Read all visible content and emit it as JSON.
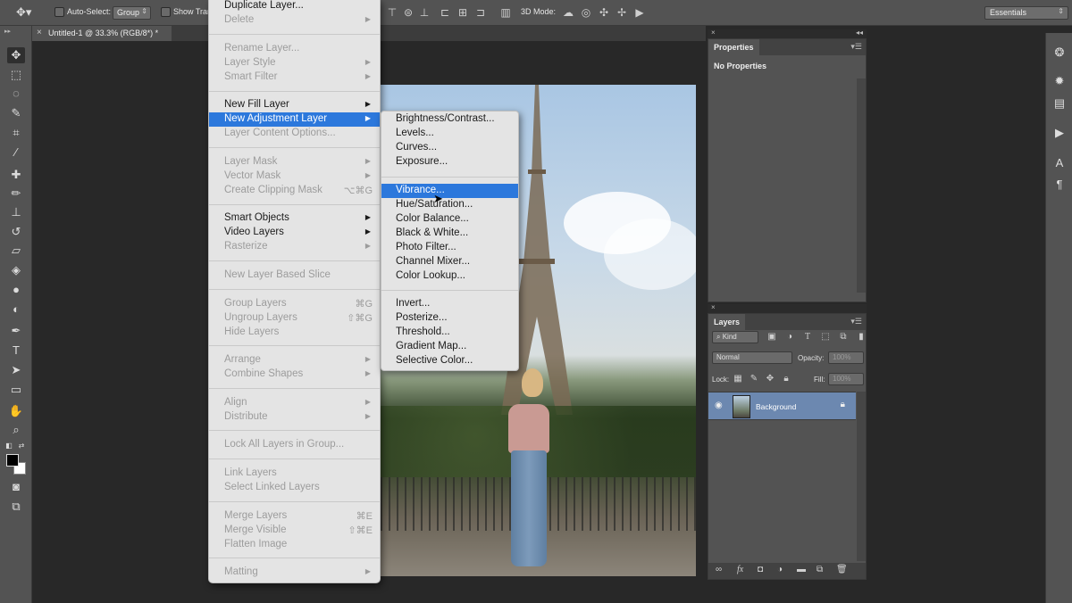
{
  "options_bar": {
    "auto_select_label": "Auto-Select:",
    "auto_select_value": "Group",
    "show_transform_label": "Show Tran",
    "mode_3d_label": "3D Mode:",
    "workspace": "Essentials"
  },
  "document_tab": {
    "title": "Untitled-1 @ 33.3% (RGB/8*) *",
    "close": "×"
  },
  "layer_menu": {
    "items": [
      {
        "label": "Duplicate Layer...",
        "enabled": true
      },
      {
        "label": "Delete",
        "enabled": false,
        "submenu": true
      },
      {
        "label": "Rename Layer...",
        "enabled": false
      },
      {
        "label": "Layer Style",
        "enabled": false,
        "submenu": true
      },
      {
        "label": "Smart Filter",
        "enabled": false,
        "submenu": true
      },
      {
        "label": "New Fill Layer",
        "enabled": true,
        "submenu": true
      },
      {
        "label": "New Adjustment Layer",
        "enabled": true,
        "submenu": true,
        "highlighted": true
      },
      {
        "label": "Layer Content Options...",
        "enabled": false
      },
      {
        "label": "Layer Mask",
        "enabled": false,
        "submenu": true
      },
      {
        "label": "Vector Mask",
        "enabled": false,
        "submenu": true
      },
      {
        "label": "Create Clipping Mask",
        "enabled": false,
        "shortcut": "⌥⌘G"
      },
      {
        "label": "Smart Objects",
        "enabled": true,
        "submenu": true
      },
      {
        "label": "Video Layers",
        "enabled": true,
        "submenu": true
      },
      {
        "label": "Rasterize",
        "enabled": false,
        "submenu": true
      },
      {
        "label": "New Layer Based Slice",
        "enabled": false
      },
      {
        "label": "Group Layers",
        "enabled": false,
        "shortcut": "⌘G"
      },
      {
        "label": "Ungroup Layers",
        "enabled": false,
        "shortcut": "⇧⌘G"
      },
      {
        "label": "Hide Layers",
        "enabled": false
      },
      {
        "label": "Arrange",
        "enabled": false,
        "submenu": true
      },
      {
        "label": "Combine Shapes",
        "enabled": false,
        "submenu": true
      },
      {
        "label": "Align",
        "enabled": false,
        "submenu": true
      },
      {
        "label": "Distribute",
        "enabled": false,
        "submenu": true
      },
      {
        "label": "Lock All Layers in Group...",
        "enabled": false
      },
      {
        "label": "Link Layers",
        "enabled": false
      },
      {
        "label": "Select Linked Layers",
        "enabled": false
      },
      {
        "label": "Merge Layers",
        "enabled": false,
        "shortcut": "⌘E"
      },
      {
        "label": "Merge Visible",
        "enabled": false,
        "shortcut": "⇧⌘E"
      },
      {
        "label": "Flatten Image",
        "enabled": false
      },
      {
        "label": "Matting",
        "enabled": false,
        "submenu": true
      }
    ]
  },
  "adjustment_submenu": {
    "items": [
      "Brightness/Contrast...",
      "Levels...",
      "Curves...",
      "Exposure...",
      "Vibrance...",
      "Hue/Saturation...",
      "Color Balance...",
      "Black & White...",
      "Photo Filter...",
      "Channel Mixer...",
      "Color Lookup...",
      "Invert...",
      "Posterize...",
      "Threshold...",
      "Gradient Map...",
      "Selective Color..."
    ],
    "highlighted": "Vibrance..."
  },
  "properties_panel": {
    "tab": "Properties",
    "message": "No Properties"
  },
  "layers_panel": {
    "tab": "Layers",
    "filter_kind": "Kind",
    "blend_mode": "Normal",
    "opacity_label": "Opacity:",
    "opacity_value": "100%",
    "lock_label": "Lock:",
    "fill_label": "Fill:",
    "fill_value": "100%",
    "layer_name": "Background"
  },
  "colors": {
    "menu_highlight": "#2c78dc",
    "panel_bg": "#535353",
    "layer_selected": "#6c88b0"
  }
}
